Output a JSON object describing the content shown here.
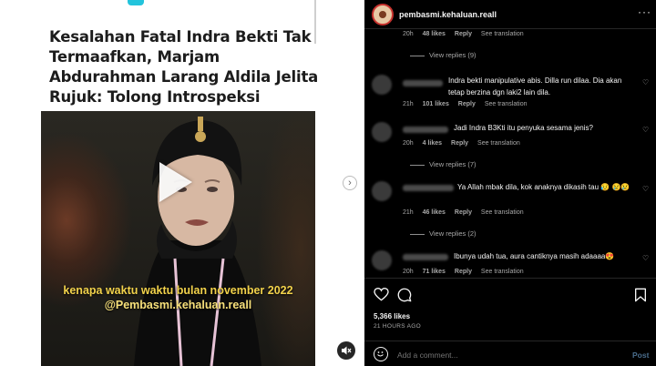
{
  "article": {
    "headline": "Kesalahan Fatal Indra Bekti Tak Termaafkan, Marjam Abdurahman Larang Aldila Jelita Rujuk: Tolong Introspeksi"
  },
  "video": {
    "caption_line1": "kenapa waktu waktu bulan november 2022",
    "caption_line2": "@Pembasmi.kehaluan.reall"
  },
  "post": {
    "username": "pembasmi.kehaluan.reall",
    "likes": "5,366 likes",
    "time_ago": "21 HOURS AGO",
    "comment_placeholder": "Add a comment...",
    "post_label": "Post"
  },
  "comments": [
    {
      "id": "c0",
      "text": "",
      "time": "20h",
      "likes": "48 likes",
      "reply": "Reply",
      "translate": "See translation"
    },
    {
      "id": "c1",
      "text": "Indra bekti manipulative abis. Dilla run dilaa. Dia akan tetap berzina dgn laki2 lain dila.",
      "time": "21h",
      "likes": "101 likes",
      "reply": "Reply",
      "translate": "See translation"
    },
    {
      "id": "c2",
      "text": "Jadi Indra B3Kti itu penyuka sesama jenis?",
      "time": "20h",
      "likes": "4 likes",
      "reply": "Reply",
      "translate": "See translation"
    },
    {
      "id": "c3",
      "text": "Ya Allah mbak dila, kok anaknya dikasih tau 😥 😢😢",
      "time": "21h",
      "likes": "46 likes",
      "reply": "Reply",
      "translate": "See translation"
    },
    {
      "id": "c4",
      "text": "Ibunya udah tua, aura cantiknya masih adaaaa😍",
      "time": "20h",
      "likes": "71 likes",
      "reply": "Reply",
      "translate": "See translation"
    }
  ],
  "view_replies": {
    "r0": "View replies (9)",
    "r2": "View replies (7)",
    "r3": "View replies (2)"
  },
  "icons": {
    "more": "more-options-icon",
    "heart": "heart-icon",
    "comment": "comment-icon",
    "bookmark": "bookmark-icon",
    "emoji": "emoji-icon",
    "mute": "mute-icon",
    "next": "chevron-right-icon",
    "play": "play-icon"
  },
  "colors": {
    "headline_text": "#1c1c1c",
    "panel_bg": "#000000",
    "caption": "#f2d24b",
    "accent_cyan": "#23c4dc",
    "post_button": "#4a6d8c"
  }
}
